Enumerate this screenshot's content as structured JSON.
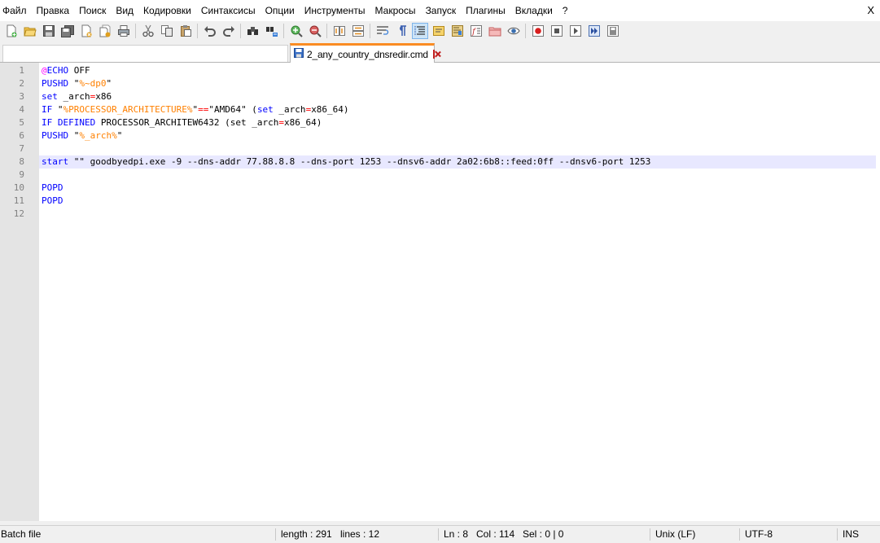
{
  "menu": {
    "items": [
      "Файл",
      "Правка",
      "Поиск",
      "Вид",
      "Кодировки",
      "Синтаксисы",
      "Опции",
      "Инструменты",
      "Макросы",
      "Запуск",
      "Плагины",
      "Вкладки",
      "?"
    ],
    "close_glyph": "X"
  },
  "toolbar": {
    "buttons": [
      {
        "icon": "new-file-icon"
      },
      {
        "icon": "open-file-icon"
      },
      {
        "icon": "save-icon"
      },
      {
        "icon": "save-all-icon"
      },
      {
        "icon": "close-file-icon"
      },
      {
        "icon": "close-all-icon"
      },
      {
        "icon": "print-icon"
      },
      {
        "icon": "cut-icon"
      },
      {
        "icon": "copy-icon"
      },
      {
        "icon": "paste-icon"
      },
      {
        "icon": "undo-icon"
      },
      {
        "icon": "redo-icon"
      },
      {
        "icon": "find-icon"
      },
      {
        "icon": "replace-icon"
      },
      {
        "icon": "zoom-in-icon"
      },
      {
        "icon": "zoom-out-icon"
      },
      {
        "icon": "sync-vertical-icon"
      },
      {
        "icon": "sync-horizontal-icon"
      },
      {
        "icon": "word-wrap-icon"
      },
      {
        "icon": "show-all-characters-icon"
      },
      {
        "icon": "indent-guide-icon",
        "active": true
      },
      {
        "icon": "user-defined-language-icon"
      },
      {
        "icon": "document-map-icon"
      },
      {
        "icon": "function-list-icon"
      },
      {
        "icon": "folder-as-workspace-icon"
      },
      {
        "icon": "monitoring-icon"
      },
      {
        "icon": "record-macro-icon"
      },
      {
        "icon": "stop-recording-icon"
      },
      {
        "icon": "playback-macro-icon"
      },
      {
        "icon": "run-macro-multiple-icon"
      },
      {
        "icon": "save-macro-icon"
      }
    ]
  },
  "tabs": {
    "active_tab": {
      "label": "2_any_country_dnsredir.cmd"
    }
  },
  "editor": {
    "current_line": 8,
    "lines": [
      {
        "number": "1",
        "tokens": [
          {
            "t": "@",
            "c": "at"
          },
          {
            "t": "ECHO",
            "c": "keyword"
          },
          {
            "t": " OFF",
            "c": "plain"
          }
        ]
      },
      {
        "number": "2",
        "tokens": [
          {
            "t": "PUSHD",
            "c": "keyword"
          },
          {
            "t": " \"",
            "c": "plain"
          },
          {
            "t": "%~dp0",
            "c": "var"
          },
          {
            "t": "\"",
            "c": "plain"
          }
        ]
      },
      {
        "number": "3",
        "tokens": [
          {
            "t": "set",
            "c": "keyword"
          },
          {
            "t": " _arch",
            "c": "plain"
          },
          {
            "t": "=",
            "c": "op"
          },
          {
            "t": "x86",
            "c": "plain"
          }
        ]
      },
      {
        "number": "4",
        "tokens": [
          {
            "t": "IF",
            "c": "keyword"
          },
          {
            "t": " \"",
            "c": "plain"
          },
          {
            "t": "%PROCESSOR_ARCHITECTURE%",
            "c": "var"
          },
          {
            "t": "\"",
            "c": "plain"
          },
          {
            "t": "==",
            "c": "op"
          },
          {
            "t": "\"AMD64\" (",
            "c": "plain"
          },
          {
            "t": "set",
            "c": "keyword"
          },
          {
            "t": " _arch",
            "c": "plain"
          },
          {
            "t": "=",
            "c": "op"
          },
          {
            "t": "x86_64)",
            "c": "plain"
          }
        ]
      },
      {
        "number": "5",
        "tokens": [
          {
            "t": "IF DEFINED",
            "c": "keyword"
          },
          {
            "t": " PROCESSOR_ARCHITEW6432 (set _arch",
            "c": "plain"
          },
          {
            "t": "=",
            "c": "op"
          },
          {
            "t": "x86_64)",
            "c": "plain"
          }
        ]
      },
      {
        "number": "6",
        "tokens": [
          {
            "t": "PUSHD",
            "c": "keyword"
          },
          {
            "t": " \"",
            "c": "plain"
          },
          {
            "t": "%_arch%",
            "c": "var"
          },
          {
            "t": "\"",
            "c": "plain"
          }
        ]
      },
      {
        "number": "7",
        "tokens": []
      },
      {
        "number": "8",
        "tokens": [
          {
            "t": "start",
            "c": "keyword"
          },
          {
            "t": " \"\" goodbyedpi.exe -9 --dns-addr 77.88.8.8 --dns-port 1253 --dnsv6-addr 2a02:6b8::feed:0ff --dnsv6-port 1253",
            "c": "plain"
          }
        ]
      },
      {
        "number": "9",
        "tokens": []
      },
      {
        "number": "10",
        "tokens": [
          {
            "t": "POPD",
            "c": "keyword"
          }
        ]
      },
      {
        "number": "11",
        "tokens": [
          {
            "t": "POPD",
            "c": "keyword"
          }
        ]
      },
      {
        "number": "12",
        "tokens": []
      }
    ]
  },
  "status": {
    "file_type": "Batch file",
    "length": "length : 291",
    "lines": "lines : 12",
    "ln": "Ln : 8",
    "col": "Col : 114",
    "sel": "Sel : 0 | 0",
    "eol": "Unix (LF)",
    "encoding": "UTF-8",
    "mode": "INS"
  }
}
